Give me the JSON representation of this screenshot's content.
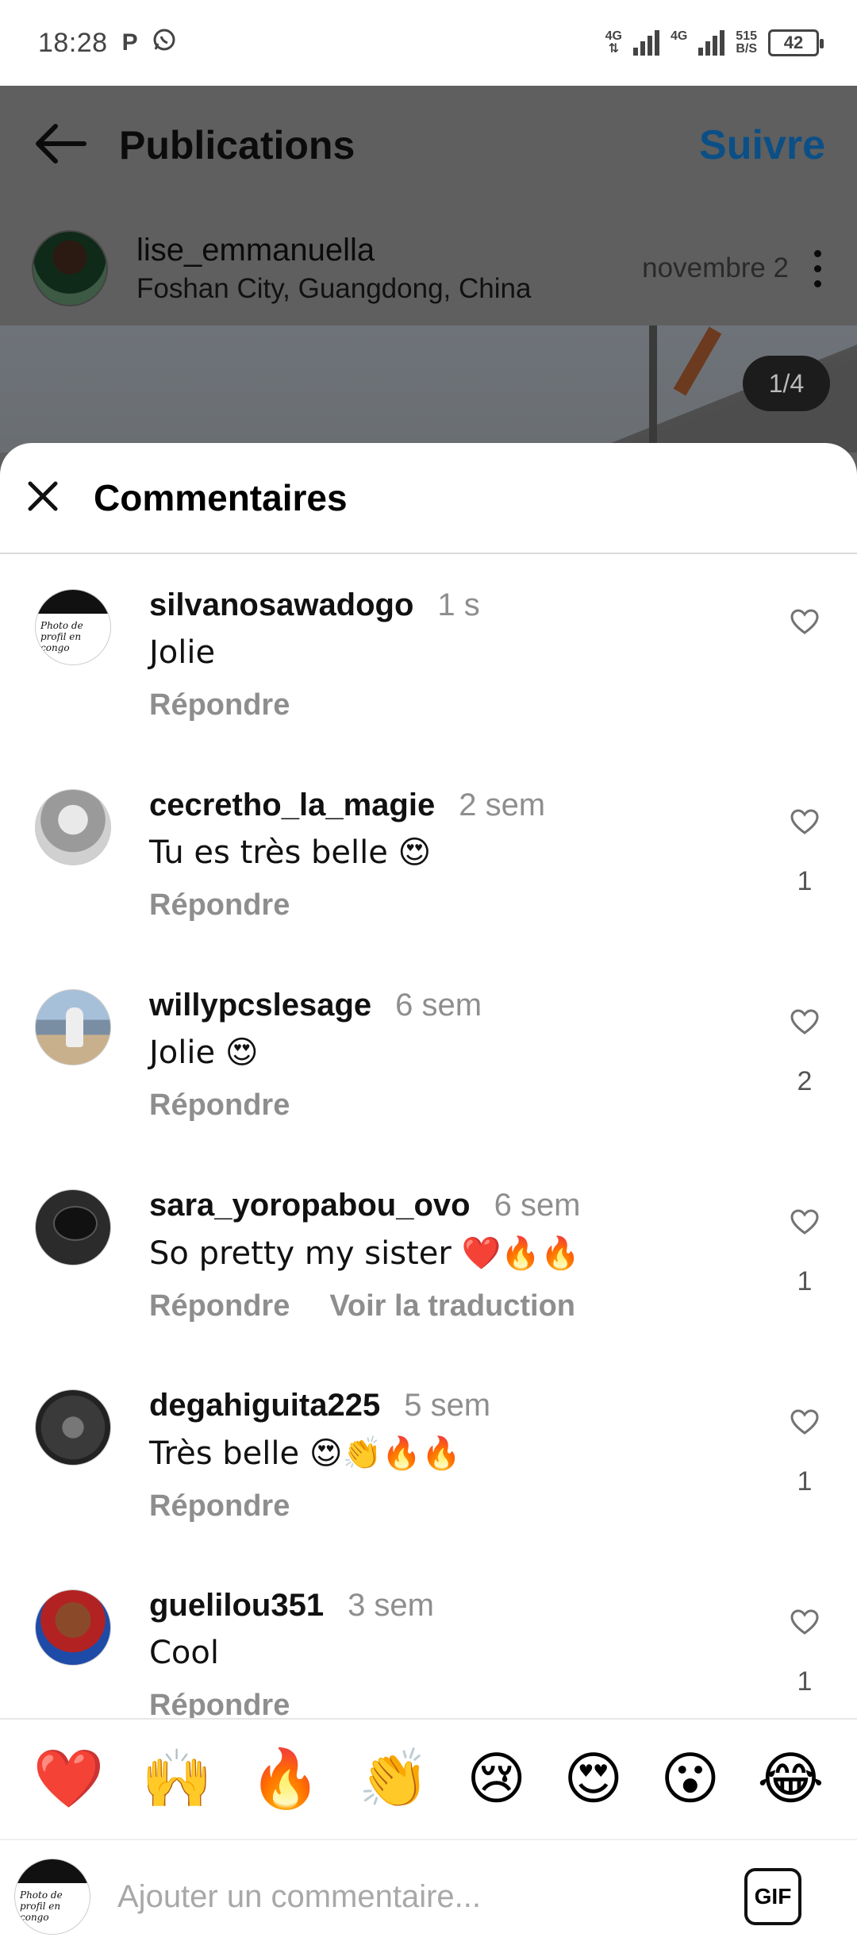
{
  "status_bar": {
    "time": "18:28",
    "left_icons": [
      "parking-p-icon",
      "whatsapp-icon"
    ],
    "network1": "4G",
    "network2": "4G",
    "speed_value": "515",
    "speed_unit": "B/S",
    "battery": "42"
  },
  "header": {
    "title": "Publications",
    "follow_label": "Suivre"
  },
  "post": {
    "username": "lise_emmanuella",
    "location": "Foshan City, Guangdong, China",
    "date": "novembre 2",
    "image_counter": "1/4"
  },
  "sheet": {
    "title": "Commentaires"
  },
  "comments": [
    {
      "username": "silvanosawadogo",
      "time": "1 s",
      "text": "Jolie",
      "reply": "Répondre",
      "likes": "",
      "translate": ""
    },
    {
      "username": "cecretho_la_magie",
      "time": "2 sem",
      "text": "Tu es très belle 😍",
      "reply": "Répondre",
      "likes": "1",
      "translate": ""
    },
    {
      "username": "willypcslesage",
      "time": "6 sem",
      "text": "Jolie 😍",
      "reply": "Répondre",
      "likes": "2",
      "translate": ""
    },
    {
      "username": "sara_yoropabou_ovo",
      "time": "6 sem",
      "text": "So pretty my sister ❤️🔥🔥",
      "reply": "Répondre",
      "likes": "1",
      "translate": "Voir la traduction"
    },
    {
      "username": "degahiguita225",
      "time": "5 sem",
      "text": "Très belle 😍👏🔥🔥",
      "reply": "Répondre",
      "likes": "1",
      "translate": ""
    },
    {
      "username": "guelilou351",
      "time": "3 sem",
      "text": "Cool",
      "reply": "Répondre",
      "likes": "1",
      "translate": ""
    }
  ],
  "avatar_text": "Photo de profil en congo",
  "emoji_bar": [
    "❤️",
    "🙌",
    "🔥",
    "👏",
    "😢",
    "😍",
    "😮",
    "😂"
  ],
  "composer": {
    "placeholder": "Ajouter un commentaire...",
    "gif_label": "GIF"
  }
}
